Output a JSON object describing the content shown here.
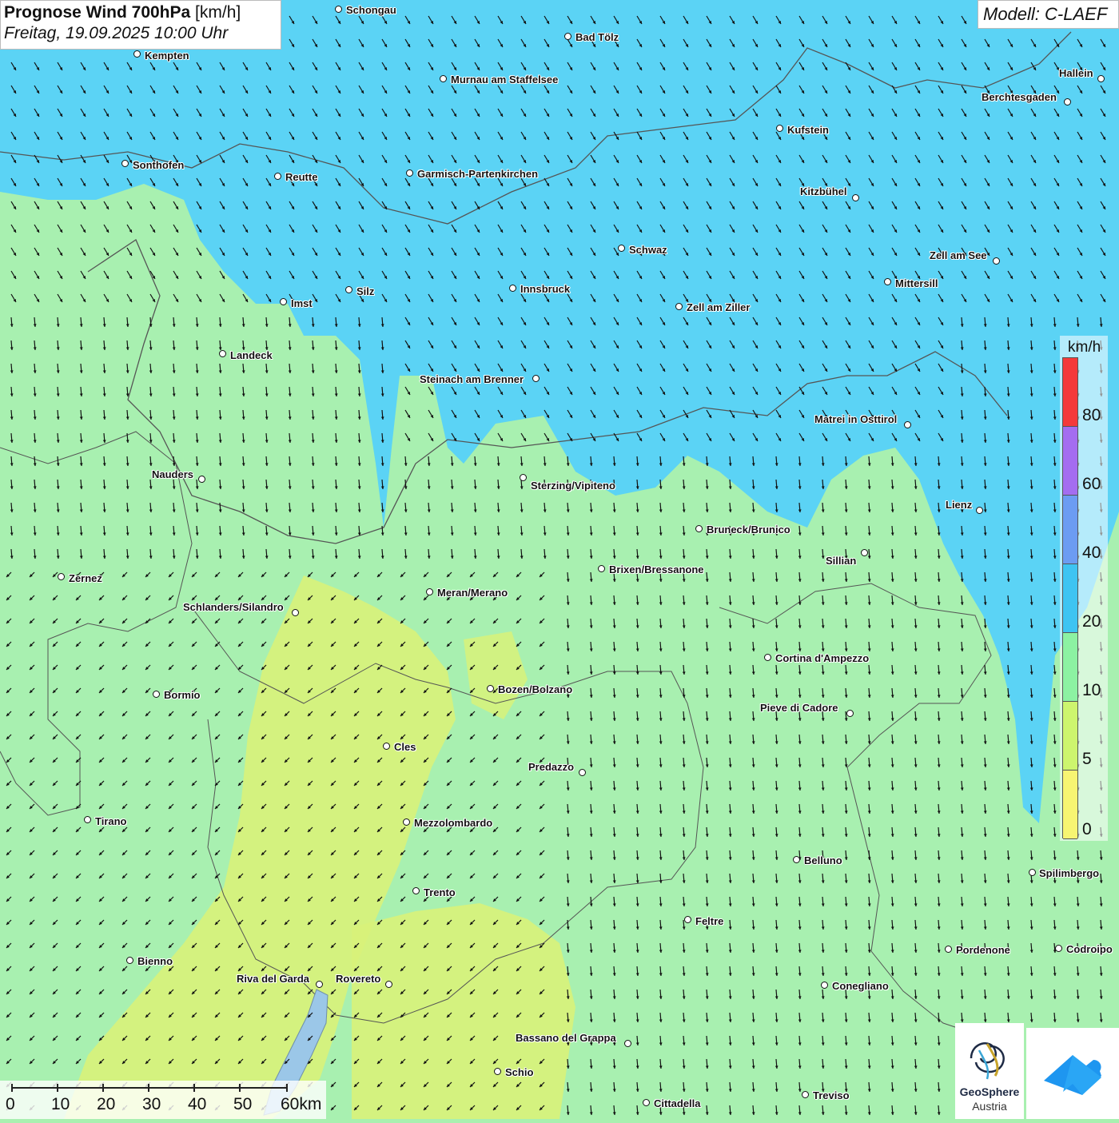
{
  "title": {
    "main": "Prognose Wind 700hPa",
    "unit": "[km/h]",
    "subtitle": "Freitag, 19.09.2025 10:00 Uhr"
  },
  "model": "Modell: C-LAEF",
  "legend": {
    "unit": "km/h",
    "ticks": [
      "80",
      "60",
      "40",
      "20",
      "10",
      "5",
      "0"
    ],
    "colors": [
      "#f43a3a",
      "#a46df0",
      "#6c9cf2",
      "#3ec4f2",
      "#8cf2a2",
      "#cdf56e",
      "#f7f572"
    ]
  },
  "scale_bar": {
    "labels": [
      "0",
      "10",
      "20",
      "30",
      "40",
      "50",
      "60km"
    ]
  },
  "cities": [
    "Schongau",
    "Bad Tölz",
    "Kempten",
    "Murnau am Staffelsee",
    "Hallein",
    "Berchtesgaden",
    "Kufstein",
    "Sonthofen",
    "Reutte",
    "Garmisch-Partenkirchen",
    "Kitzbühel",
    "Schwaz",
    "Zell am See",
    "Silz",
    "Innsbruck",
    "Mittersill",
    "Imst",
    "Zell am Ziller",
    "Landeck",
    "Steinach am Brenner",
    "Matrei in Osttirol",
    "Nauders",
    "Sterzing/Vipiteno",
    "Lienz",
    "Bruneck/Brunico",
    "Sillian",
    "Zernez",
    "Brixen/Bressanone",
    "Meran/Merano",
    "Schlanders/Silandro",
    "Cortina d'Ampezzo",
    "Bozen/Bolzano",
    "Bormio",
    "Pieve di Cadore",
    "Cles",
    "Predazzo",
    "Tirano",
    "Mezzolombardo",
    "Belluno",
    "Spilimbergo",
    "Trento",
    "Feltre",
    "Pordenone",
    "Codroipo",
    "Bienno",
    "Riva del Garda",
    "Rovereto",
    "Conegliano",
    "Bassano del Grappa",
    "Schio",
    "Treviso",
    "Cittadella"
  ],
  "logo": {
    "name_line1": "GeoSphere",
    "name_line2": "Austria"
  },
  "colors": {
    "wind_10_20": "#a8f0b0",
    "wind_20_40": "#5bd3f5",
    "wind_5_10": "#d8f27a",
    "arrow": "#111111"
  }
}
